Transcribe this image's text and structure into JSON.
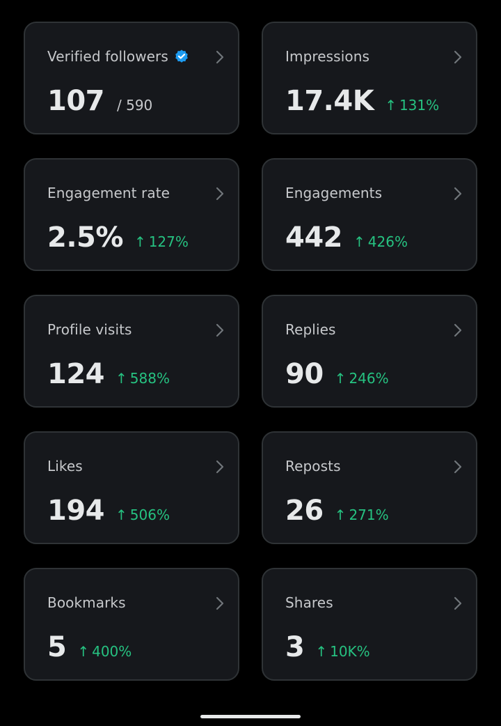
{
  "cards": [
    {
      "title": "Verified followers",
      "value": "107",
      "sub": "/ 590",
      "verified": true,
      "icons": [
        "verified-badge-icon",
        "chevron-right-icon"
      ]
    },
    {
      "title": "Impressions",
      "value": "17.4K",
      "change": "131%",
      "arrow": "↑"
    },
    {
      "title": "Engagement rate",
      "value": "2.5%",
      "change": "127%",
      "arrow": "↑"
    },
    {
      "title": "Engagements",
      "value": "442",
      "change": "426%",
      "arrow": "↑"
    },
    {
      "title": "Profile visits",
      "value": "124",
      "change": "588%",
      "arrow": "↑"
    },
    {
      "title": "Replies",
      "value": "90",
      "change": "246%",
      "arrow": "↑"
    },
    {
      "title": "Likes",
      "value": "194",
      "change": "506%",
      "arrow": "↑"
    },
    {
      "title": "Reposts",
      "value": "26",
      "change": "271%",
      "arrow": "↑"
    },
    {
      "title": "Bookmarks",
      "value": "5",
      "change": "400%",
      "arrow": "↑"
    },
    {
      "title": "Shares",
      "value": "3",
      "change": "10K%",
      "arrow": "↑"
    }
  ],
  "colors": {
    "background": "#000000",
    "card": "#16181c",
    "card_border": "#2f3336",
    "positive_change": "#26c281",
    "verified_badge": "#1d9bf0"
  }
}
